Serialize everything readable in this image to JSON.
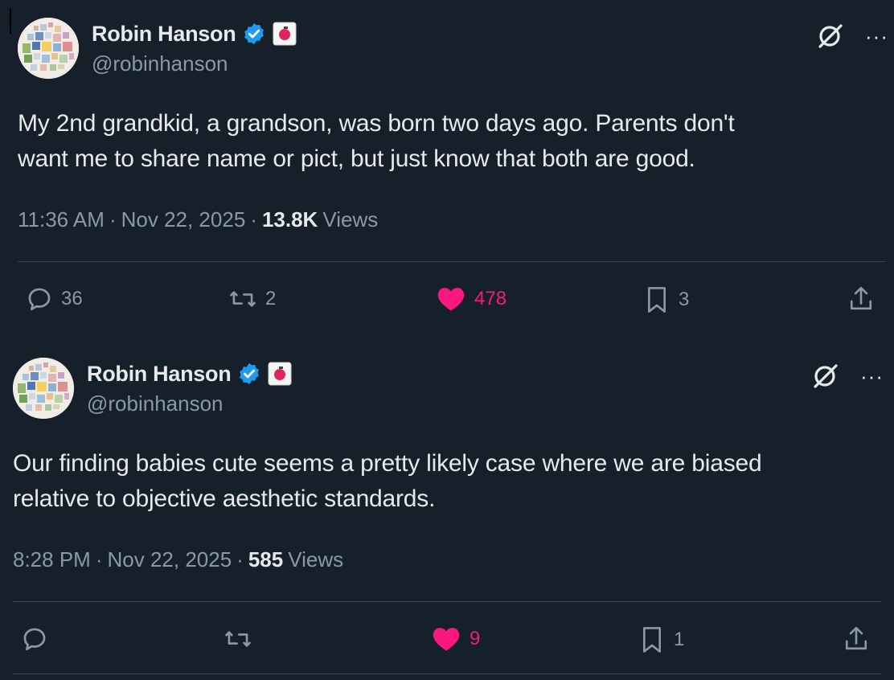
{
  "tweets": [
    {
      "author": {
        "display_name": "Robin Hanson",
        "handle": "@robinhanson"
      },
      "text_lines": [
        "My 2nd grandkid, a grandson, was born two days ago. Parents don't",
        "want me to share name or pict, but just know that both are good."
      ],
      "time": "11:36 AM",
      "separator": "·",
      "date": "Nov 22, 2025",
      "views_count": "13.8K",
      "views_label": "Views",
      "actions": {
        "replies": "36",
        "reposts": "2",
        "likes": "478",
        "bookmarks": "3",
        "share": ""
      }
    },
    {
      "author": {
        "display_name": "Robin Hanson",
        "handle": "@robinhanson"
      },
      "text_lines": [
        "Our finding babies cute seems a pretty likely case where we are biased",
        "relative to objective aesthetic standards."
      ],
      "time": "8:28 PM",
      "separator": "·",
      "date": "Nov 22, 2025",
      "views_count": "585",
      "views_label": "Views",
      "actions": {
        "replies": "",
        "reposts": "",
        "likes": "9",
        "bookmarks": "1",
        "share": ""
      }
    }
  ],
  "icons": {
    "verified": "verified-badge-icon",
    "affiliate": "affiliate-badge-icon",
    "grok": "grok-icon",
    "more": "more-icon",
    "reply": "reply-icon",
    "repost": "repost-icon",
    "like": "heart-icon",
    "bookmark": "bookmark-icon",
    "share": "share-icon"
  },
  "colors": {
    "background": "#15202b",
    "text": "#e7e9ea",
    "muted": "#8b98a5",
    "like": "#f91880",
    "verified": "#1d9bf0",
    "divider": "#38444d"
  },
  "more_glyph": "···"
}
